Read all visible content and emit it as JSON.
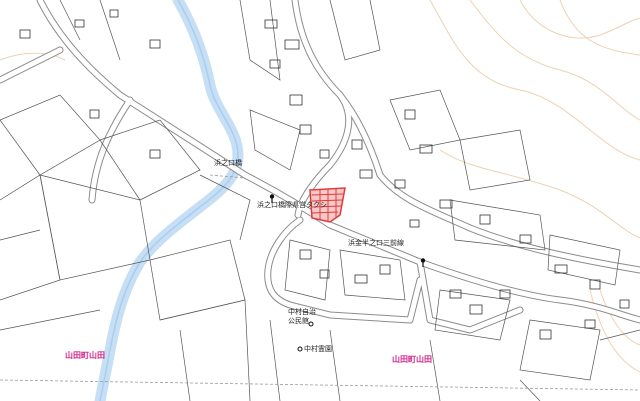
{
  "map": {
    "colors": {
      "background": "#ffffff",
      "road": "#9a9a9a",
      "river": "#c6dff5",
      "contour": "#e8c9a3",
      "district_label": "#d0208a",
      "lot_number": "#c0187a",
      "highlight": "#e23a3a"
    },
    "place_labels": {
      "road_name_1": "浜之口橋",
      "road_name_2": "浜之口橋際県営タクシ",
      "road_name_3": "浜金半之口三前線",
      "facility_1": "中村自治",
      "facility_2": "公民館",
      "facility_3": "中村霊園"
    },
    "district_labels": {
      "left": "山田町山田",
      "right": "山田町山田"
    },
    "icons": [
      "bus-stop-icon",
      "bus-stop-icon",
      "facility-icon"
    ]
  }
}
